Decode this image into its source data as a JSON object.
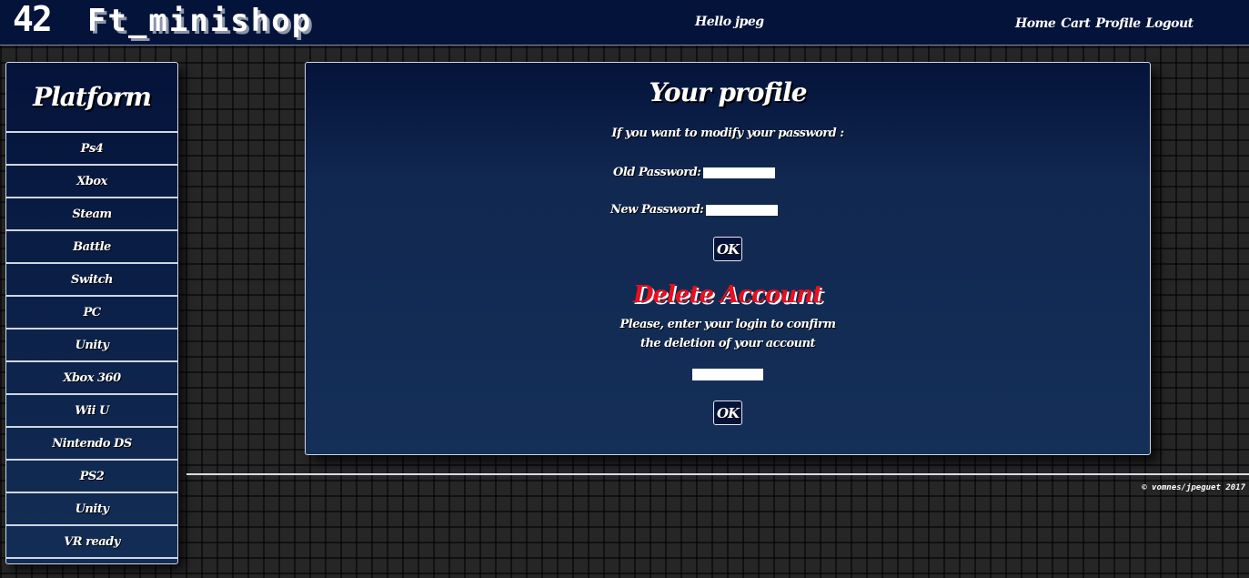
{
  "header": {
    "logo": "42",
    "title": "Ft_minishop",
    "greeting": "Hello jpeg",
    "nav": [
      "Home",
      "Cart",
      "Profile",
      "Logout"
    ]
  },
  "sidebar": {
    "title": "Platform",
    "items": [
      "Ps4",
      "Xbox",
      "Steam",
      "Battle",
      "Switch",
      "PC",
      "Unity",
      "Xbox 360",
      "Wii U",
      "Nintendo DS",
      "PS2",
      "Unity",
      "VR ready"
    ]
  },
  "profile": {
    "title": "Your profile",
    "intro": "If you want to modify your password :",
    "old_password_label": "Old Password:",
    "old_password_value": "",
    "new_password_label": "New Password:",
    "new_password_value": "",
    "ok_label": "OK",
    "delete_title": "Delete Account",
    "delete_text": "Please, enter your login to confirm the deletion of your account",
    "login_value": "",
    "delete_ok_label": "OK"
  },
  "footer": {
    "copyright": "© vomnes/jpeguet 2017"
  },
  "colors": {
    "header_bg": "#04133a",
    "panel_bg": "#142f58",
    "delete_red": "#e8101e",
    "border": "#cfd6e4"
  }
}
